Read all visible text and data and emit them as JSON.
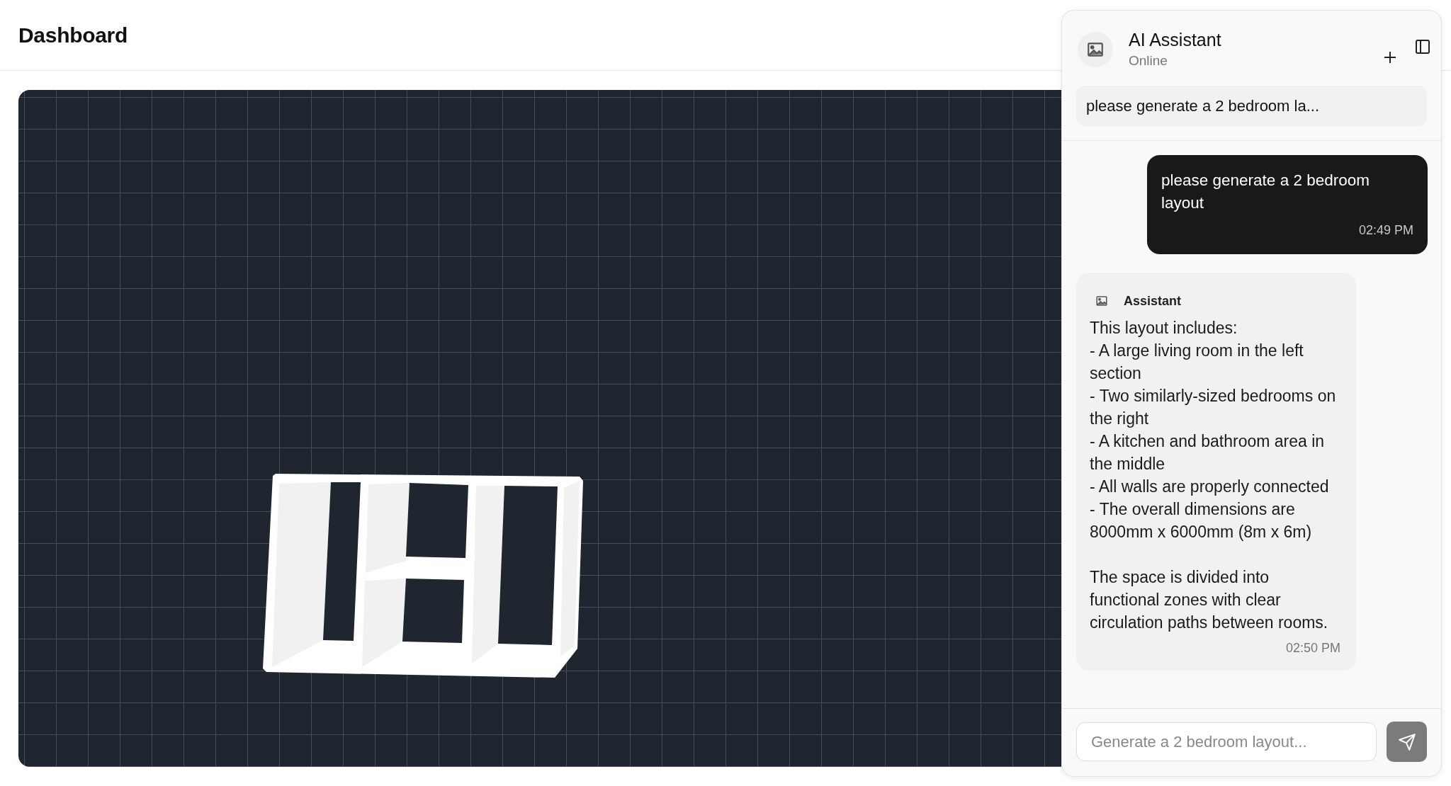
{
  "header": {
    "title": "Dashboard"
  },
  "chat": {
    "title": "AI Assistant",
    "status": "Online",
    "conversations": [
      {
        "title": "please generate a 2 bedroom la..."
      }
    ],
    "messages": [
      {
        "kind": "user",
        "text": "please generate a 2 bedroom layout",
        "time": "02:49 PM"
      },
      {
        "kind": "assistant",
        "sender": "Assistant",
        "text": "This layout includes:\n- A large living room in the left section\n- Two similarly-sized bedrooms on the right\n- A kitchen and bathroom area in the middle\n- All walls are properly connected\n- The overall dimensions are 8000mm x 6000mm (8m x 6m)\n\nThe space is divided into functional zones with clear circulation paths between rooms.",
        "time": "02:50 PM"
      }
    ],
    "input": {
      "placeholder": "Generate a 2 bedroom layout..."
    }
  }
}
